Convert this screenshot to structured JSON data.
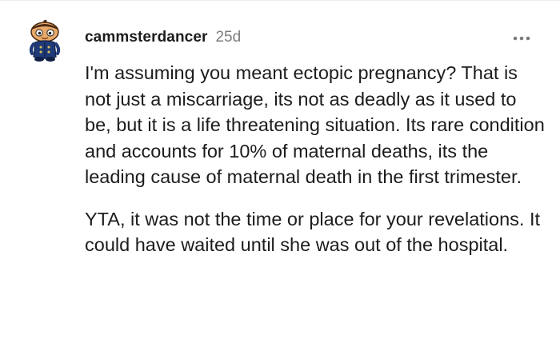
{
  "comment": {
    "username": "cammsterdancer",
    "timestamp": "25d",
    "avatar": "snoo-avatar",
    "more_icon": "more-horizontal-icon",
    "paragraphs": [
      "I'm assuming you meant ectopic pregnancy? That is not just a miscarriage, its not as deadly as it used to be, but it is a life threatening situation. Its rare condition and accounts for 10% of maternal deaths, its the leading cause of maternal death in the first trimester.",
      "YTA, it was not the time or place for your revelations. It could have waited until she was out of the hospital."
    ]
  },
  "colors": {
    "text": "#1c1c1c",
    "meta": "#7c7c7c",
    "avatar_skin": "#e8a96a",
    "avatar_outfit": "#1f3a78",
    "avatar_hair": "#4a2a14"
  }
}
